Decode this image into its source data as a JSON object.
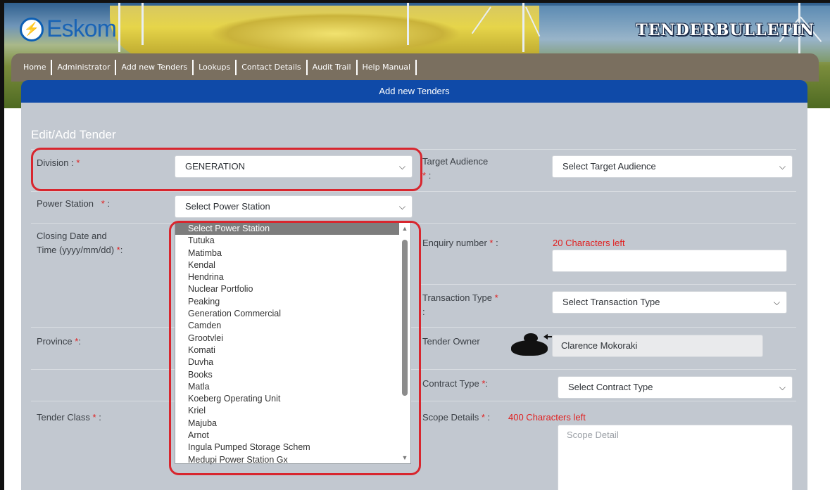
{
  "brand": {
    "logo_text": "Eskom",
    "bulletin_title": "TENDERBULLETIN"
  },
  "nav": {
    "items": [
      "Home",
      "Administrator",
      "Add new Tenders",
      "Lookups",
      "Contact Details",
      "Audit Trail",
      "Help Manual"
    ]
  },
  "section": {
    "title": "Add new Tenders"
  },
  "form": {
    "title": "Edit/Add Tender",
    "division": {
      "label": "Division :",
      "value": "GENERATION"
    },
    "target_audience": {
      "label": "Target Audience",
      "label_suffix": ":",
      "value": "Select Target Audience"
    },
    "power_station": {
      "label": "Power Station",
      "label_suffix": ":",
      "value": "Select Power Station"
    },
    "closing_date": {
      "label_line1": "Closing Date and",
      "label_line2": "Time (yyyy/mm/dd)",
      "label_suffix": ":"
    },
    "enquiry_number": {
      "label": "Enquiry number",
      "label_suffix": ":",
      "counter": "20 Characters left",
      "value": ""
    },
    "transaction_type": {
      "label": "Transaction Type",
      "label_suffix": ":",
      "value": "Select Transaction Type"
    },
    "province": {
      "label": "Province",
      "label_suffix": ":"
    },
    "tender_owner": {
      "label": "Tender Owner",
      "value": "Clarence  Mokoraki"
    },
    "contract_type": {
      "label": "Contract Type",
      "label_suffix": ":",
      "value": "Select Contract Type"
    },
    "tender_class": {
      "label": "Tender Class",
      "label_suffix": ":"
    },
    "scope_details": {
      "label": "Scope Details",
      "label_suffix": ":",
      "counter": "400 Characters left",
      "placeholder": "Scope Detail"
    },
    "required_mark": "*"
  },
  "power_station_options": [
    "Select Power Station",
    "Tutuka",
    "Matimba",
    "Kendal",
    "Hendrina",
    "Nuclear Portfolio",
    "Peaking",
    "Generation Commercial",
    "Camden",
    "Grootvlei",
    "Komati",
    "Duvha",
    "Books",
    "Matla",
    "Koeberg Operating Unit",
    "Kriel",
    "Majuba",
    "Arnot",
    "Ingula Pumped Storage Schem",
    "Medupi Power Station Gx"
  ],
  "colors": {
    "accent_blue": "#0f4aa8",
    "nav_brown": "#7a6f5f",
    "panel_gray": "#c2c8d0",
    "required_red": "#e02020",
    "highlight_red": "#d8262e"
  },
  "icons": {
    "chevron": "chevron-down-icon",
    "owner": "user-avatar-icon"
  }
}
